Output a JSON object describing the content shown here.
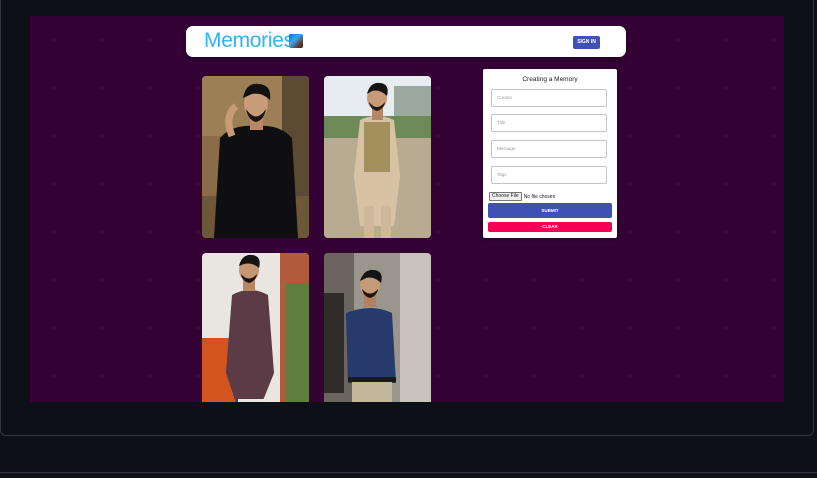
{
  "appbar": {
    "brand": "Memories",
    "logo_icon": "memories-logo-icon",
    "signin_label": "SIGN IN"
  },
  "memories": [
    {
      "photo": "man-black-shalwar-kameez-photo"
    },
    {
      "photo": "man-beige-waistcoat-photo"
    },
    {
      "photo": "man-purple-kurta-photo"
    },
    {
      "photo": "man-navy-shirt-photo"
    }
  ],
  "form": {
    "title": "Creating a Memory",
    "creator_placeholder": "Creator",
    "title_placeholder": "Title",
    "message_placeholder": "Message",
    "tags_placeholder": "Tags",
    "file_button": "Choose File",
    "file_status": "No file chosen",
    "submit_label": "SUBMIT",
    "clear_label": "CLEAR"
  },
  "colors": {
    "page_bg": "#0d1117",
    "app_bg": "#340235",
    "brand": "#29b6f6",
    "primary": "#3f51b5",
    "secondary": "#f50057"
  }
}
